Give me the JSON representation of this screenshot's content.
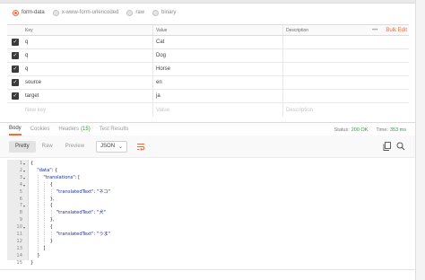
{
  "body_types": [
    {
      "label": "form-data",
      "selected": true
    },
    {
      "label": "x-www-form-urlencoded",
      "selected": false
    },
    {
      "label": "raw",
      "selected": false
    },
    {
      "label": "binary",
      "selected": false
    }
  ],
  "params": {
    "headers": {
      "key": "Key",
      "value": "Value",
      "description": "Description",
      "more": "•••",
      "bulk_edit": "Bulk Edit"
    },
    "rows": [
      {
        "key": "q",
        "value": "Cat",
        "checked": true
      },
      {
        "key": "q",
        "value": "Dog",
        "checked": true
      },
      {
        "key": "q",
        "value": "Horse",
        "checked": true
      },
      {
        "key": "source",
        "value": "en",
        "checked": true
      },
      {
        "key": "target",
        "value": "ja",
        "checked": true
      }
    ],
    "placeholders": {
      "key": "New key",
      "value": "Value",
      "description": "Description"
    }
  },
  "response_tabs": [
    {
      "label": "Body",
      "active": true,
      "count": ""
    },
    {
      "label": "Cookies",
      "active": false,
      "count": ""
    },
    {
      "label": "Headers",
      "active": false,
      "count": "(15)"
    },
    {
      "label": "Test Results",
      "active": false,
      "count": ""
    }
  ],
  "status": {
    "status_label": "Status:",
    "status_value": "200 OK",
    "time_label": "Time:",
    "time_value": "353 ms"
  },
  "view": {
    "pretty": "Pretty",
    "raw": "Raw",
    "preview": "Preview",
    "format": "JSON",
    "format_caret": "⌄"
  },
  "icons": {
    "wrap": "wrap-lines-icon",
    "copy": "copy-icon",
    "search": "search-icon"
  },
  "colors": {
    "accent": "#f26b3a",
    "status_ok": "#2d9b3d",
    "json_string": "#1a2ea8"
  },
  "code_lines": [
    {
      "n": "1",
      "fold": "▾",
      "indent": 0,
      "pre": "{",
      "str": "",
      "post": ""
    },
    {
      "n": "2",
      "fold": "▾",
      "indent": 1,
      "pre": "",
      "str": "\"data\"",
      "post": ": {"
    },
    {
      "n": "3",
      "fold": "▾",
      "indent": 2,
      "pre": "",
      "str": "\"translations\"",
      "post": ": ["
    },
    {
      "n": "4",
      "fold": "▾",
      "indent": 3,
      "pre": "{",
      "str": "",
      "post": ""
    },
    {
      "n": "5",
      "fold": "",
      "indent": 4,
      "pre": "",
      "str": "\"translatedText\"",
      "post": ": ",
      "str2": "\"ネコ\""
    },
    {
      "n": "6",
      "fold": "",
      "indent": 3,
      "pre": "},",
      "str": "",
      "post": ""
    },
    {
      "n": "7",
      "fold": "▾",
      "indent": 3,
      "pre": "{",
      "str": "",
      "post": ""
    },
    {
      "n": "8",
      "fold": "",
      "indent": 4,
      "pre": "",
      "str": "\"translatedText\"",
      "post": ": ",
      "str2": "\"犬\""
    },
    {
      "n": "9",
      "fold": "",
      "indent": 3,
      "pre": "},",
      "str": "",
      "post": ""
    },
    {
      "n": "10",
      "fold": "▾",
      "indent": 3,
      "pre": "{",
      "str": "",
      "post": ""
    },
    {
      "n": "11",
      "fold": "",
      "indent": 4,
      "pre": "",
      "str": "\"translatedText\"",
      "post": ": ",
      "str2": "\"うま\""
    },
    {
      "n": "12",
      "fold": "",
      "indent": 3,
      "pre": "}",
      "str": "",
      "post": ""
    },
    {
      "n": "13",
      "fold": "",
      "indent": 2,
      "pre": "]",
      "str": "",
      "post": ""
    },
    {
      "n": "14",
      "fold": "",
      "indent": 1,
      "pre": "}",
      "str": "",
      "post": ""
    },
    {
      "n": "15",
      "fold": "",
      "indent": 0,
      "pre": "}",
      "str": "",
      "post": ""
    }
  ]
}
